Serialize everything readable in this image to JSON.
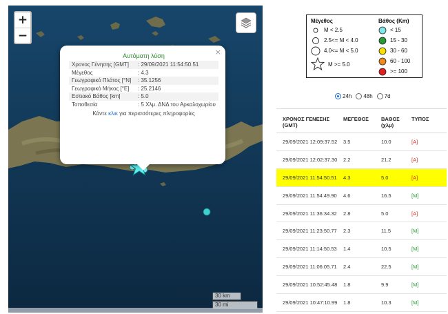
{
  "map": {
    "zoom_in": "+",
    "zoom_out": "−",
    "scale_km": "30 km",
    "scale_mi": "30 mi",
    "popup": {
      "title": "Αυτόματη λύση",
      "close": "×",
      "rows": [
        {
          "k": "Χρονος Γένησης [GMT]",
          "v": ": 29/09/2021 11:54:50.51"
        },
        {
          "k": "Μέγεθος",
          "v": ": 4.3"
        },
        {
          "k": "Γεωγραφικό Πλάτος [°N]",
          "v": ": 35.1256"
        },
        {
          "k": "Γεωγραφικό Μήκος [°E]",
          "v": ": 25.2146"
        },
        {
          "k": "Εστιακό Βάθος [km]",
          "v": ": 5.0"
        },
        {
          "k": "Τοποθεσία",
          "v": ": 5 Χλμ. ΔΝΔ του Αρκαλοχωρίου"
        }
      ],
      "more_prefix": "Κάντε",
      "more_link": "κλικ",
      "more_suffix": "για περισσότερες πληροφορίες"
    }
  },
  "legend": {
    "magnitude_title": "Μέγεθος",
    "depth_title": "Βάθος (Km)",
    "magnitudes": [
      "M < 2.5",
      "2.5<= M < 4.0",
      "4.0<= M < 5.0",
      "M >= 5.0"
    ],
    "depths": [
      {
        "label": "< 15",
        "color": "#7fe8e8"
      },
      {
        "label": "15 - 30",
        "color": "#2a9a38"
      },
      {
        "label": "30 - 60",
        "color": "#f5e000"
      },
      {
        "label": "60 - 100",
        "color": "#f08a1c"
      },
      {
        "label": ">= 100",
        "color": "#e02020"
      }
    ]
  },
  "filter": {
    "options": [
      "24h",
      "48h",
      "7d"
    ],
    "selected": "24h"
  },
  "table": {
    "headers": [
      "ΧΡΟΝΟΣ ΓΕΝΕΣΗΣ (GMT)",
      "ΜΕΓΕΘΟΣ",
      "ΒΑΘΟΣ (χλμ)",
      "ΤΥΠΟΣ"
    ],
    "rows": [
      {
        "time": "29/09/2021 12:09:37.52",
        "mag": "3.5",
        "depth": "10.0",
        "type": "[A]"
      },
      {
        "time": "29/09/2021 12:02:37.30",
        "mag": "2.2",
        "depth": "21.2",
        "type": "[A]"
      },
      {
        "time": "29/09/2021 11:54:50.51",
        "mag": "4.3",
        "depth": "5.0",
        "type": "[A]",
        "highlight": true
      },
      {
        "time": "29/09/2021 11:54:49.90",
        "mag": "4.6",
        "depth": "16.5",
        "type": "[M]"
      },
      {
        "time": "29/09/2021 11:36:34.32",
        "mag": "2.8",
        "depth": "5.0",
        "type": "[A]"
      },
      {
        "time": "29/09/2021 11:23:50.77",
        "mag": "2.3",
        "depth": "11.5",
        "type": "[M]"
      },
      {
        "time": "29/09/2021 11:14:50.53",
        "mag": "1.4",
        "depth": "10.5",
        "type": "[M]"
      },
      {
        "time": "29/09/2021 11:06:05.71",
        "mag": "2.4",
        "depth": "22.5",
        "type": "[M]"
      },
      {
        "time": "29/09/2021 10:52:45.48",
        "mag": "1.8",
        "depth": "9.9",
        "type": "[M]"
      },
      {
        "time": "29/09/2021 10:47:10.99",
        "mag": "1.8",
        "depth": "10.3",
        "type": "[M]"
      }
    ]
  },
  "colors": {
    "highlight": "#ffff00",
    "type_auto": "#d9342b",
    "type_manual": "#2a9a38",
    "popup_title": "#2e8b2e"
  }
}
